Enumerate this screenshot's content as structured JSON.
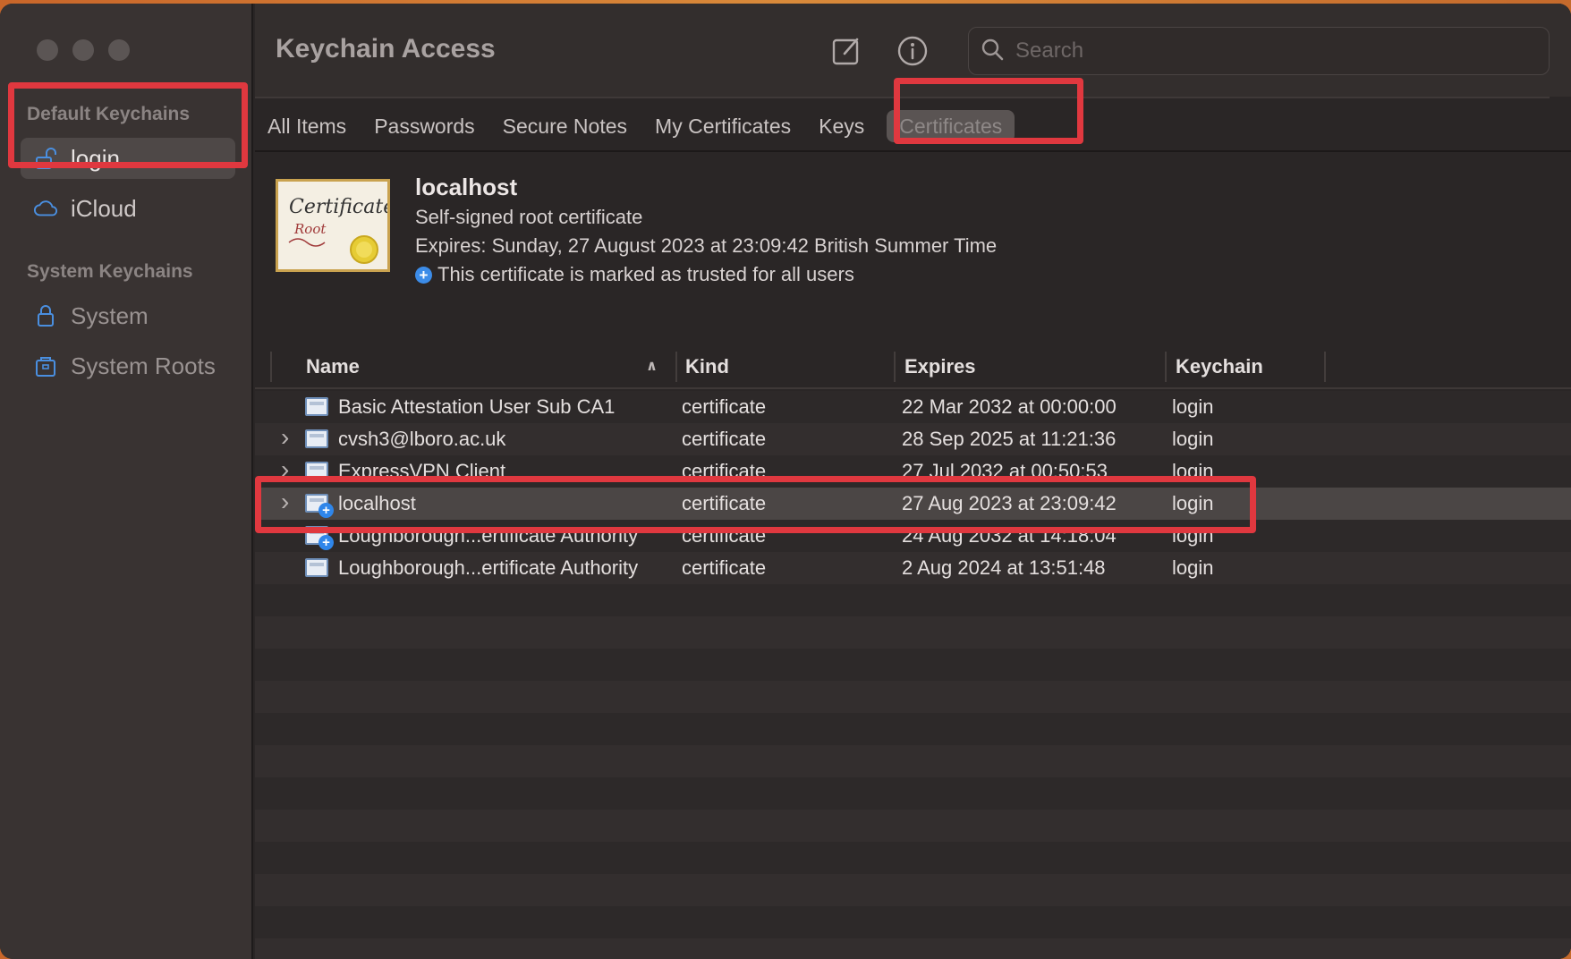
{
  "window": {
    "title": "Keychain Access"
  },
  "sidebar": {
    "default_section": "Default Keychains",
    "system_section": "System Keychains",
    "items": [
      {
        "label": "login",
        "icon": "unlock-icon",
        "selected": true
      },
      {
        "label": "iCloud",
        "icon": "cloud-icon"
      },
      {
        "label": "System",
        "icon": "lock-icon"
      },
      {
        "label": "System Roots",
        "icon": "cabinet-icon"
      }
    ]
  },
  "toolbar": {
    "search_placeholder": "Search",
    "new_icon": "compose-icon",
    "info_icon": "info-icon"
  },
  "tabs": [
    "All Items",
    "Passwords",
    "Secure Notes",
    "My Certificates",
    "Keys",
    "Certificates"
  ],
  "selected_tab": "Certificates",
  "detail": {
    "name": "localhost",
    "subtitle": "Self-signed root certificate",
    "expires": "Expires: Sunday, 27 August 2023 at 23:09:42 British Summer Time",
    "trust": "This certificate is marked as trusted for all users",
    "image_text_1": "Certificate",
    "image_text_2": "Root"
  },
  "table": {
    "columns": [
      "Name",
      "Kind",
      "Expires",
      "Keychain"
    ],
    "rows": [
      {
        "name": "Basic Attestation User Sub CA1",
        "kind": "certificate",
        "expires": "22 Mar 2032 at 00:00:00",
        "keychain": "login",
        "expand": false,
        "trusted": false
      },
      {
        "name": "cvsh3@lboro.ac.uk",
        "kind": "certificate",
        "expires": "28 Sep 2025 at 11:21:36",
        "keychain": "login",
        "expand": true,
        "trusted": false
      },
      {
        "name": "ExpressVPN Client",
        "kind": "certificate",
        "expires": "27 Jul 2032 at 00:50:53",
        "keychain": "login",
        "expand": true,
        "trusted": false
      },
      {
        "name": "localhost",
        "kind": "certificate",
        "expires": "27 Aug 2023 at 23:09:42",
        "keychain": "login",
        "expand": true,
        "trusted": true,
        "selected": true
      },
      {
        "name": "Loughborough...ertificate Authority",
        "kind": "certificate",
        "expires": "24 Aug 2032 at 14:18:04",
        "keychain": "login",
        "expand": false,
        "trusted": true
      },
      {
        "name": "Loughborough...ertificate Authority",
        "kind": "certificate",
        "expires": "2 Aug 2024 at 13:51:48",
        "keychain": "login",
        "expand": false,
        "trusted": false
      }
    ]
  },
  "colors": {
    "annotation": "#e0383f",
    "accent": "#2f86ea"
  }
}
